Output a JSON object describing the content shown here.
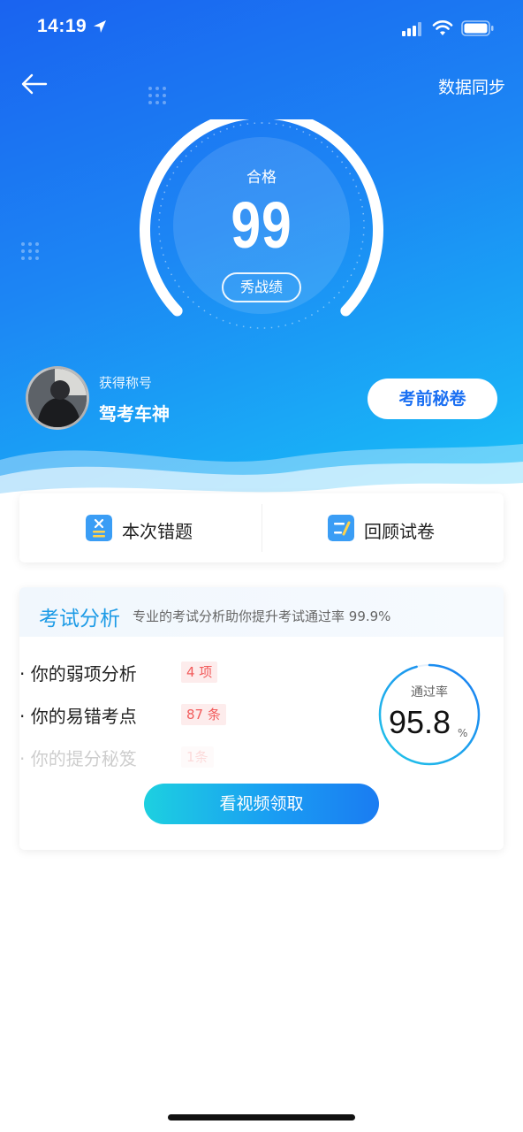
{
  "status_bar": {
    "time": "14:19"
  },
  "header": {
    "back_icon": "arrow-left-icon",
    "sync_label": "数据同步"
  },
  "gauge": {
    "status": "合格",
    "score": "99",
    "share_label": "秀战绩"
  },
  "title_section": {
    "label": "获得称号",
    "name": "驾考车神",
    "secret_button": "考前秘卷"
  },
  "actions": {
    "wrong_questions": "本次错题",
    "review_paper": "回顾试卷"
  },
  "analysis": {
    "title": "考试分析",
    "subtitle": "专业的考试分析助你提升考试通过率 99.9%",
    "items": [
      {
        "label": "· 你的弱项分析",
        "tag": "4 项"
      },
      {
        "label": "· 你的易错考点",
        "tag": "87 条"
      },
      {
        "label": "· 你的提分秘笈",
        "tag": "1条"
      }
    ],
    "rate_label": "通过率",
    "rate_value": "95.8",
    "rate_unit": "%",
    "video_button": "看视频领取"
  },
  "colors": {
    "primary_blue": "#1a6ff2",
    "accent_cyan": "#1d9be6",
    "tag_red": "#f25b5b"
  }
}
